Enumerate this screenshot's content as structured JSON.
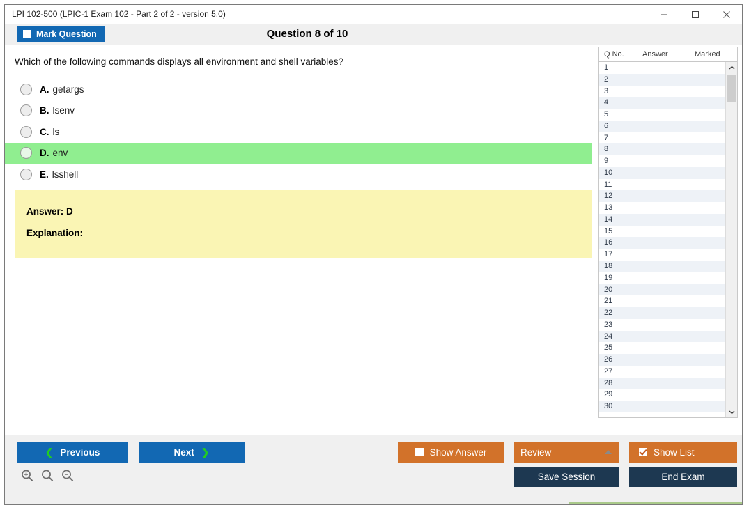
{
  "window": {
    "title": "LPI 102-500 (LPIC-1 Exam 102 - Part 2 of 2 - version 5.0)",
    "minimize_label": "minimize",
    "maximize_label": "maximize",
    "close_label": "close"
  },
  "header": {
    "mark_question_label": "Mark Question",
    "mark_question_checked": false,
    "question_counter": "Question 8 of 10"
  },
  "question": {
    "text": "Which of the following commands displays all environment and shell variables?",
    "options": [
      {
        "letter": "A.",
        "text": "getargs",
        "correct": false
      },
      {
        "letter": "B.",
        "text": "lsenv",
        "correct": false
      },
      {
        "letter": "C.",
        "text": "ls",
        "correct": false
      },
      {
        "letter": "D.",
        "text": "env",
        "correct": true
      },
      {
        "letter": "E.",
        "text": "lsshell",
        "correct": false
      }
    ]
  },
  "answer_panel": {
    "answer_label": "Answer: D",
    "explanation_label": "Explanation:"
  },
  "question_list": {
    "headers": {
      "q_no": "Q No.",
      "answer": "Answer",
      "marked": "Marked"
    },
    "rows": [
      {
        "num": "1",
        "answer": "",
        "marked": ""
      },
      {
        "num": "2",
        "answer": "",
        "marked": ""
      },
      {
        "num": "3",
        "answer": "",
        "marked": ""
      },
      {
        "num": "4",
        "answer": "",
        "marked": ""
      },
      {
        "num": "5",
        "answer": "",
        "marked": ""
      },
      {
        "num": "6",
        "answer": "",
        "marked": ""
      },
      {
        "num": "7",
        "answer": "",
        "marked": ""
      },
      {
        "num": "8",
        "answer": "",
        "marked": ""
      },
      {
        "num": "9",
        "answer": "",
        "marked": ""
      },
      {
        "num": "10",
        "answer": "",
        "marked": ""
      },
      {
        "num": "11",
        "answer": "",
        "marked": ""
      },
      {
        "num": "12",
        "answer": "",
        "marked": ""
      },
      {
        "num": "13",
        "answer": "",
        "marked": ""
      },
      {
        "num": "14",
        "answer": "",
        "marked": ""
      },
      {
        "num": "15",
        "answer": "",
        "marked": ""
      },
      {
        "num": "16",
        "answer": "",
        "marked": ""
      },
      {
        "num": "17",
        "answer": "",
        "marked": ""
      },
      {
        "num": "18",
        "answer": "",
        "marked": ""
      },
      {
        "num": "19",
        "answer": "",
        "marked": ""
      },
      {
        "num": "20",
        "answer": "",
        "marked": ""
      },
      {
        "num": "21",
        "answer": "",
        "marked": ""
      },
      {
        "num": "22",
        "answer": "",
        "marked": ""
      },
      {
        "num": "23",
        "answer": "",
        "marked": ""
      },
      {
        "num": "24",
        "answer": "",
        "marked": ""
      },
      {
        "num": "25",
        "answer": "",
        "marked": ""
      },
      {
        "num": "26",
        "answer": "",
        "marked": ""
      },
      {
        "num": "27",
        "answer": "",
        "marked": ""
      },
      {
        "num": "28",
        "answer": "",
        "marked": ""
      },
      {
        "num": "29",
        "answer": "",
        "marked": ""
      },
      {
        "num": "30",
        "answer": "",
        "marked": ""
      }
    ]
  },
  "footer": {
    "previous_label": "Previous",
    "next_label": "Next",
    "show_answer_label": "Show Answer",
    "show_answer_checked": false,
    "review_label": "Review",
    "show_list_label": "Show List",
    "show_list_checked": true,
    "save_session_label": "Save Session",
    "end_exam_label": "End Exam",
    "zoom_in_label": "zoom-in",
    "zoom_reset_label": "zoom-reset",
    "zoom_out_label": "zoom-out"
  },
  "colors": {
    "primary_blue": "#1268b3",
    "accent_orange": "#d2722a",
    "dark_navy": "#1d3851",
    "correct_green": "#90ee90",
    "answer_yellow": "#faf5b4",
    "chevron_green": "#22cc22"
  }
}
